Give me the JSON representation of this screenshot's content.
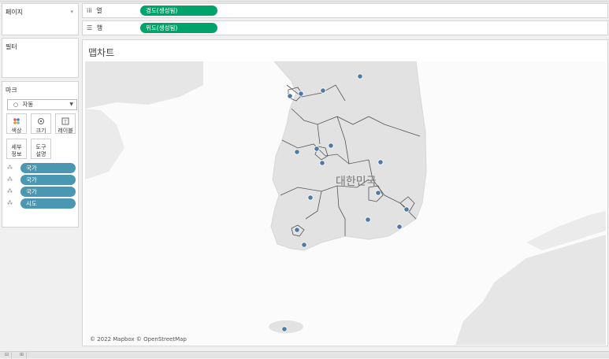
{
  "pages_card": {
    "title": "페이지"
  },
  "filters_card": {
    "title": "필터"
  },
  "marks_card": {
    "title": "마크",
    "mark_type": "자동",
    "buttons": [
      {
        "label": "색상",
        "icon": "color-dots-icon"
      },
      {
        "label": "크기",
        "icon": "size-icon"
      },
      {
        "label": "레이블",
        "icon": "label-icon"
      },
      {
        "label": "세부\n정보",
        "icon": "detail-icon"
      },
      {
        "label": "도구\n설명",
        "icon": "tooltip-icon"
      }
    ],
    "detail_fields": [
      "국가",
      "국가",
      "국가",
      "시도"
    ]
  },
  "shelves": {
    "columns": {
      "label": "열",
      "pill": "경도(생성됨)"
    },
    "rows": {
      "label": "행",
      "pill": "위도(생성됨)"
    }
  },
  "viz": {
    "title": "맵차트",
    "map_label": "대한민국",
    "attribution": "© 2022 Mapbox © OpenStreetMap",
    "point_color": "#4e79a7"
  }
}
